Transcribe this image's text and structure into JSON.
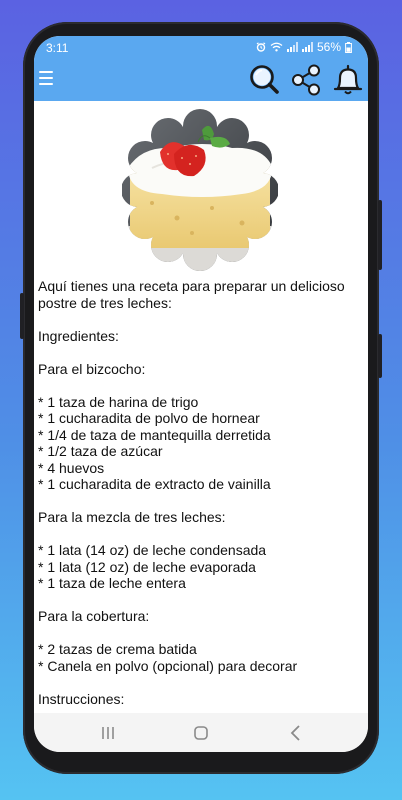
{
  "status_bar": {
    "time": "3:11",
    "battery": "56%"
  },
  "toolbar": {
    "menu_icon": "hamburger-menu-icon",
    "search_icon": "search-icon",
    "share_icon": "share-icon",
    "notifications_icon": "bell-icon",
    "color": "#5aa8f0"
  },
  "recipe": {
    "image": "tres-leches-cake-photo",
    "text": "Aquí tienes una receta para preparar un delicioso postre de tres leches:\n\nIngredientes:\n\nPara el bizcocho:\n\n* 1 taza de harina de trigo\n* 1 cucharadita de polvo de hornear\n* 1/4 de taza de mantequilla derretida\n* 1/2 taza de azúcar\n* 4 huevos\n* 1 cucharadita de extracto de vainilla\n\nPara la mezcla de tres leches:\n\n* 1 lata (14 oz) de leche condensada\n* 1 lata (12 oz) de leche evaporada\n* 1 taza de leche entera\n\nPara la cobertura:\n\n* 2 tazas de crema batida\n* Canela en polvo (opcional) para decorar\n\nInstrucciones:"
  },
  "nav_bar": {
    "recents_icon": "recent-apps-icon",
    "home_icon": "home-icon",
    "back_icon": "back-icon"
  }
}
